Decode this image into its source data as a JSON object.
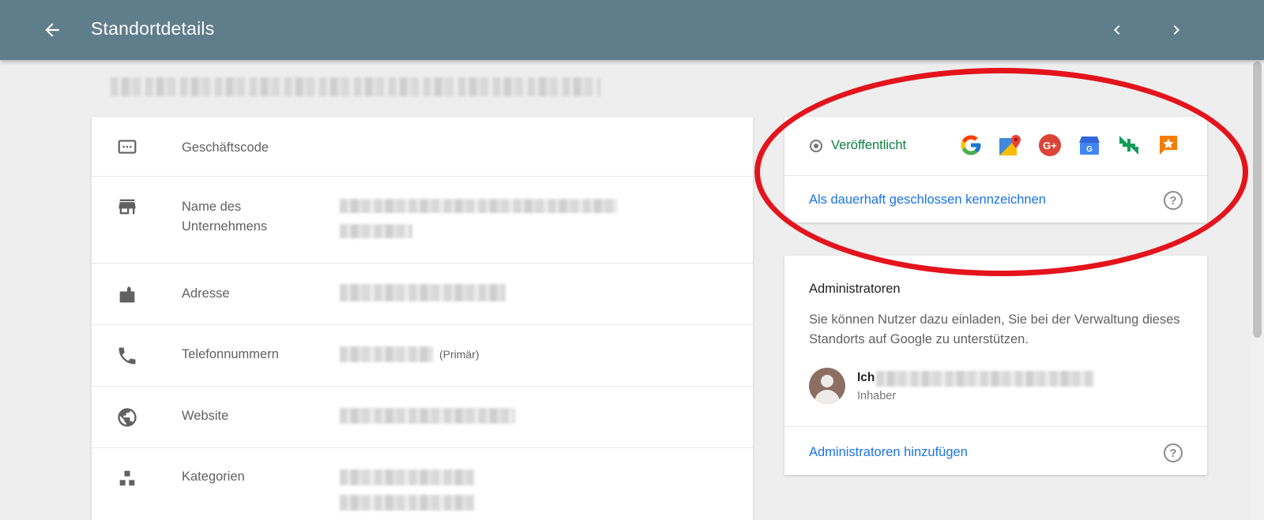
{
  "header": {
    "title": "Standortdetails",
    "back_icon": "arrow-back-icon",
    "prev_icon": "chevron-left-icon",
    "next_icon": "chevron-right-icon",
    "color": "#607d8b"
  },
  "details": {
    "rows": [
      {
        "icon": "business-code-icon",
        "label": "Geschäftscode"
      },
      {
        "icon": "store-icon",
        "label": "Name des Unternehmens"
      },
      {
        "icon": "address-icon",
        "label": "Adresse"
      },
      {
        "icon": "phone-icon",
        "label": "Telefonnummern",
        "suffix": "(Primär)"
      },
      {
        "icon": "globe-icon",
        "label": "Website"
      },
      {
        "icon": "categories-icon",
        "label": "Kategorien"
      }
    ]
  },
  "status_card": {
    "status_label": "Veröffentlicht",
    "status_color": "#0b8043",
    "services": [
      "google-search-icon",
      "google-maps-icon",
      "google-plus-icon",
      "google-my-business-icon",
      "reviews-swap-icon",
      "reviews-star-icon"
    ],
    "close_link": "Als dauerhaft geschlossen kennzeichnen",
    "help_glyph": "?"
  },
  "admin_card": {
    "heading": "Administratoren",
    "description": "Sie können Nutzer dazu einladen, Sie bei der Verwaltung dieses Standorts auf Google zu unterstützen.",
    "admin": {
      "name": "Ich",
      "role": "Inhaber"
    },
    "add_link": "Administratoren hinzufügen",
    "help_glyph": "?"
  },
  "annotation": {
    "shape": "ellipse",
    "color": "#e3141c"
  },
  "link_color": "#1a73e8"
}
